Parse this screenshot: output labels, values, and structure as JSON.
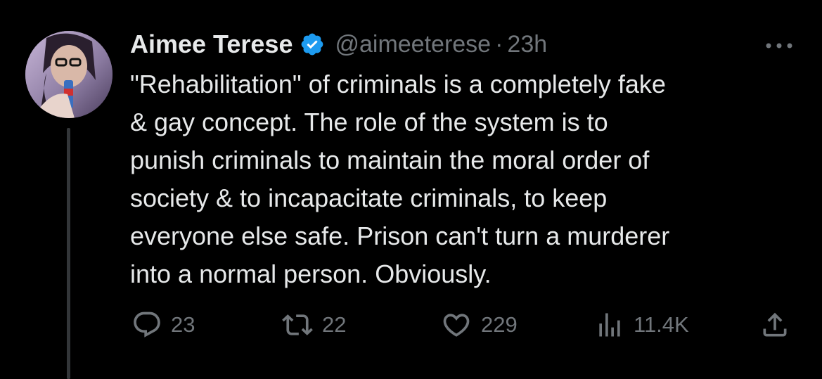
{
  "tweet": {
    "author_name": "Aimee Terese",
    "handle": "@aimeeterese",
    "separator": "·",
    "time": "23h",
    "text_lines": [
      "\"Rehabilitation\" of criminals is a completely fake",
      "& gay concept. The role of the system is to",
      "punish criminals to maintain the moral order of",
      "society & to incapacitate criminals, to keep",
      "everyone else safe. Prison can't turn a murderer",
      "into a normal person. Obviously."
    ]
  },
  "actions": {
    "replies": "23",
    "retweets": "22",
    "likes": "229",
    "views": "11.4K"
  },
  "icons": {
    "verified": "verified-badge-icon",
    "more": "more-dots-icon",
    "reply": "reply-icon",
    "retweet": "retweet-icon",
    "like": "heart-icon",
    "views": "views-icon",
    "share": "share-icon"
  },
  "colors": {
    "background": "#000000",
    "text": "#e7e9ea",
    "secondary": "#71767b",
    "verified": "#1d9bf0",
    "thread_line": "#333639"
  }
}
